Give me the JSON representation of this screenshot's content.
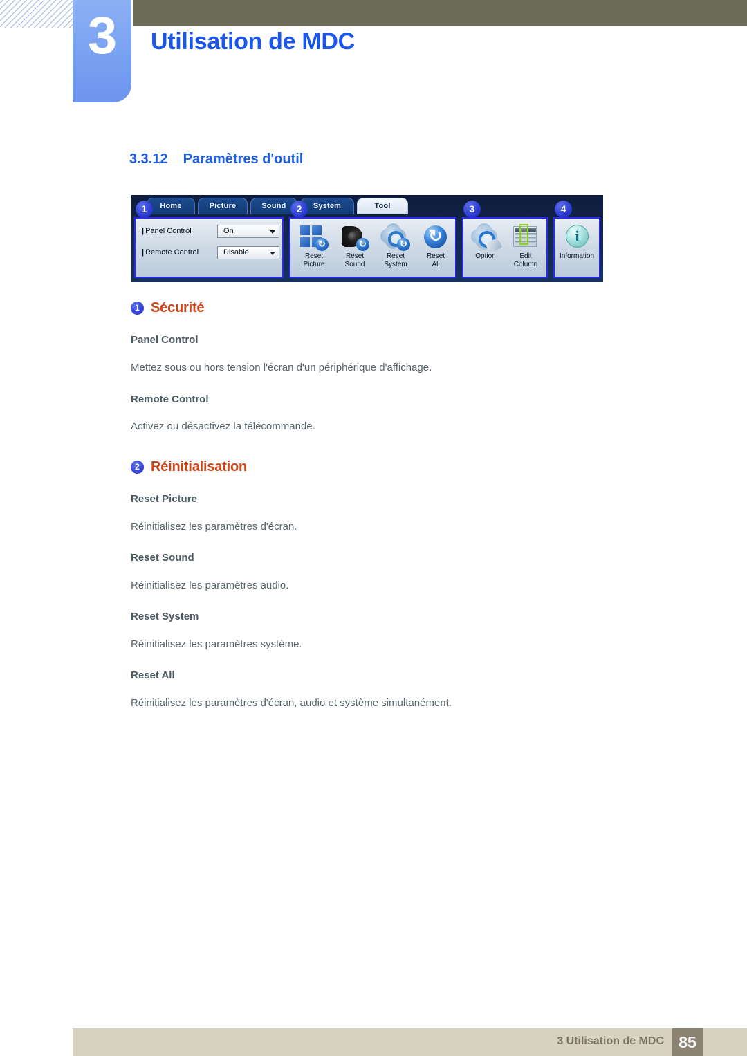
{
  "header": {
    "chapter_number": "3",
    "chapter_title": "Utilisation de MDC"
  },
  "section": {
    "number": "3.3.12",
    "title": "Paramètres d'outil"
  },
  "figure": {
    "tabs": [
      {
        "label": "Home",
        "active": false
      },
      {
        "label": "Picture",
        "active": false
      },
      {
        "label": "Sound",
        "active": false
      },
      {
        "label": "System",
        "active": false
      },
      {
        "label": "Tool",
        "active": true
      }
    ],
    "group1": {
      "callout": "1",
      "rows": [
        {
          "label": "Panel Control",
          "value": "On"
        },
        {
          "label": "Remote Control",
          "value": "Disable"
        }
      ]
    },
    "group2": {
      "callout": "2",
      "items": [
        {
          "label": "Reset\nPicture",
          "icon": "reset-picture-icon"
        },
        {
          "label": "Reset\nSound",
          "icon": "reset-sound-icon"
        },
        {
          "label": "Reset\nSystem",
          "icon": "reset-system-icon"
        },
        {
          "label": "Reset\nAll",
          "icon": "reset-all-icon"
        }
      ]
    },
    "group3": {
      "callout": "3",
      "items": [
        {
          "label": "Option",
          "icon": "option-gear-icon"
        },
        {
          "label": "Edit\nColumn",
          "icon": "edit-column-icon"
        }
      ]
    },
    "group4": {
      "callout": "4",
      "items": [
        {
          "label": "Information",
          "icon": "information-icon"
        }
      ]
    }
  },
  "content": {
    "block1": {
      "badge": "1",
      "heading": "Sécurité",
      "entries": [
        {
          "subhead": "Panel Control",
          "body": "Mettez sous ou hors tension l'écran d'un périphérique d'affichage."
        },
        {
          "subhead": "Remote Control",
          "body": "Activez ou désactivez la télécommande."
        }
      ]
    },
    "block2": {
      "badge": "2",
      "heading": "Réinitialisation",
      "entries": [
        {
          "subhead": "Reset Picture",
          "body": "Réinitialisez les paramètres d'écran."
        },
        {
          "subhead": "Reset Sound",
          "body": "Réinitialisez les paramètres audio."
        },
        {
          "subhead": "Reset System",
          "body": "Réinitialisez les paramètres système."
        },
        {
          "subhead": "Reset All",
          "body": "Réinitialisez les paramètres d'écran, audio et système simultanément."
        }
      ]
    }
  },
  "footer": {
    "text": "3 Utilisation de MDC",
    "page": "85"
  },
  "colors": {
    "olive": "#6d6c58",
    "chapter_blue": "#7ba4f2",
    "title_blue": "#1a56e8",
    "heading_blue": "#1f5fe8",
    "accent_orange": "#cc4418",
    "subhead_slate": "#4a5b61",
    "body_gray": "#58656b",
    "footer_bar": "#d6d2bf",
    "footer_page_box": "#8c8272",
    "callout_blue": "#2f3ed3"
  }
}
